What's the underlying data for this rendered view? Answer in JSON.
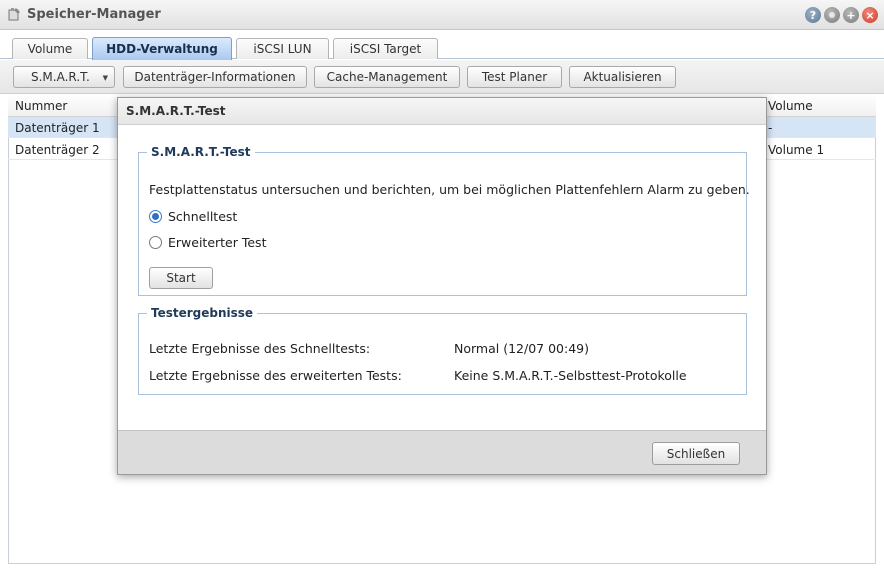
{
  "window": {
    "title": "Speicher-Manager"
  },
  "tabs": [
    {
      "label": "Volume"
    },
    {
      "label": "HDD-Verwaltung",
      "active": true
    },
    {
      "label": "iSCSI LUN"
    },
    {
      "label": "iSCSI Target"
    }
  ],
  "toolbar": {
    "smart": "S.M.A.R.T.",
    "disk_info": "Datenträger-Informationen",
    "cache": "Cache-Management",
    "test_planner": "Test Planer",
    "refresh": "Aktualisieren"
  },
  "grid": {
    "columns": {
      "number": "Nummer",
      "volume": "Volume"
    },
    "rows": [
      {
        "number": "Datenträger 1",
        "volume": "-",
        "selected": true
      },
      {
        "number": "Datenträger 2",
        "volume": "Volume 1"
      }
    ]
  },
  "dialog": {
    "title": "S.M.A.R.T.-Test",
    "test_section": {
      "legend": "S.M.A.R.T.-Test",
      "description": "Festplattenstatus untersuchen und berichten, um bei möglichen Plattenfehlern Alarm zu geben.",
      "options": [
        {
          "label": "Schnelltest",
          "checked": true
        },
        {
          "label": "Erweiterter Test",
          "checked": false
        }
      ],
      "start_button": "Start"
    },
    "results_section": {
      "legend": "Testergebnisse",
      "quick_label": "Letzte Ergebnisse des Schnelltests:",
      "quick_value": "Normal (12/07 00:49)",
      "extended_label": "Letzte Ergebnisse des erweiterten Tests:",
      "extended_value": "Keine S.M.A.R.T.-Selbsttest-Protokolle"
    },
    "close_button": "Schließen"
  },
  "colors": {
    "accent": "#2f6fc6",
    "active_tab": "#a9c9f1",
    "selected_row": "#d6e5f6",
    "close_button": "#cc3b2a"
  },
  "icons": [
    "app-icon",
    "help-icon",
    "minimize-icon",
    "maximize-icon",
    "close-icon",
    "dropdown-arrow-icon"
  ]
}
